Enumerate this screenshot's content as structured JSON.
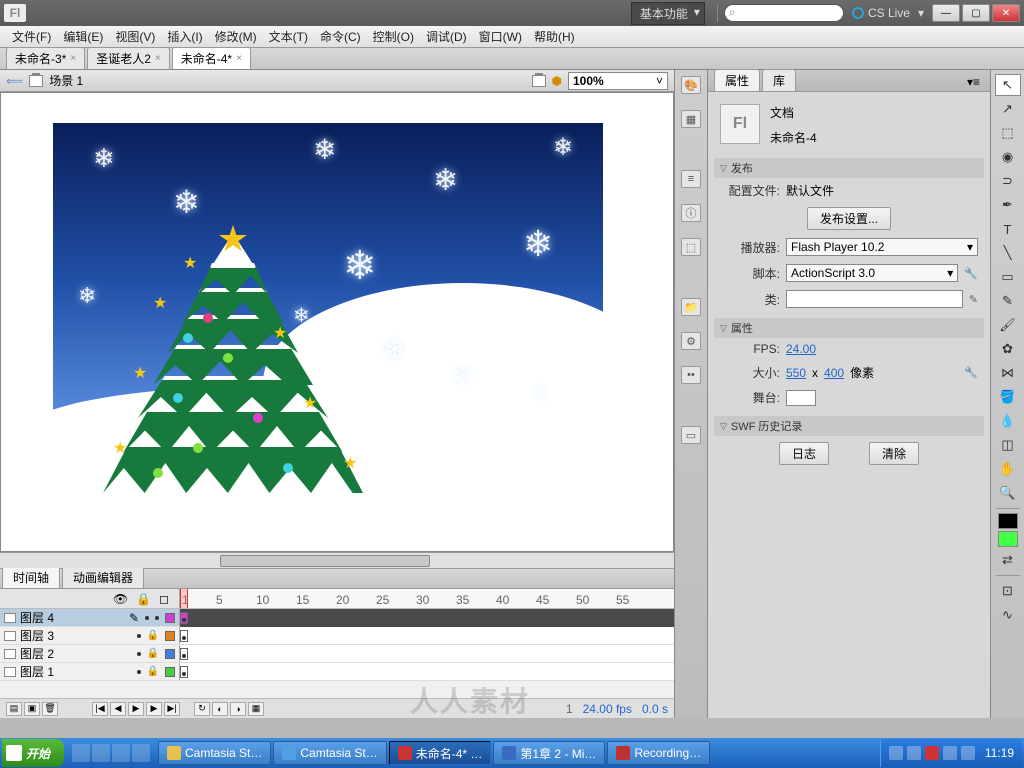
{
  "titlebar": {
    "logo": "Fl",
    "workspace": "基本功能",
    "cslive": "CS Live"
  },
  "menubar": {
    "items": [
      "文件(F)",
      "编辑(E)",
      "视图(V)",
      "插入(I)",
      "修改(M)",
      "文本(T)",
      "命令(C)",
      "控制(O)",
      "调试(D)",
      "窗口(W)",
      "帮助(H)"
    ]
  },
  "doc_tabs": {
    "items": [
      "未命名-3*",
      "圣诞老人2",
      "未命名-4*"
    ],
    "active": 2
  },
  "scene_bar": {
    "scene": "场景 1",
    "zoom": "100%"
  },
  "timeline_tabs": {
    "items": [
      "时间轴",
      "动画编辑器"
    ],
    "active": 0
  },
  "timeline": {
    "ruler": [
      "1",
      "5",
      "10",
      "15",
      "20",
      "25",
      "30",
      "35",
      "40",
      "45",
      "50",
      "55"
    ],
    "layers": [
      {
        "name": "图层 4",
        "locked": false,
        "color": "#d040d0",
        "selected": true
      },
      {
        "name": "图层 3",
        "locked": true,
        "color": "#e08020"
      },
      {
        "name": "图层 2",
        "locked": true,
        "color": "#4080e0"
      },
      {
        "name": "图层 1",
        "locked": true,
        "color": "#40d040"
      }
    ],
    "status": {
      "frame": "1",
      "fps": "24.00 fps",
      "time": "0.0 s"
    }
  },
  "properties": {
    "tabs": [
      "属性",
      "库"
    ],
    "doc_type": "文档",
    "doc_name": "未命名-4",
    "sections": {
      "publish": "发布",
      "props": "属性",
      "swf": "SWF 历史记录"
    },
    "publish": {
      "profile_label": "配置文件:",
      "profile_value": "默认文件",
      "settings_btn": "发布设置...",
      "player_label": "播放器:",
      "player_value": "Flash Player 10.2",
      "script_label": "脚本:",
      "script_value": "ActionScript 3.0",
      "class_label": "类:"
    },
    "props": {
      "fps_label": "FPS:",
      "fps_value": "24.00",
      "size_label": "大小:",
      "size_w": "550",
      "size_x": "x",
      "size_h": "400",
      "size_unit": "像素",
      "stage_label": "舞台:"
    },
    "swf": {
      "log_btn": "日志",
      "clear_btn": "清除"
    }
  },
  "taskbar": {
    "start": "开始",
    "tasks": [
      {
        "label": "Camtasia St…",
        "active": false
      },
      {
        "label": "Camtasia St…",
        "active": false
      },
      {
        "label": "未命名-4* …",
        "active": true,
        "icon": "#c33"
      },
      {
        "label": "第1章 2 - Mi…",
        "active": false
      },
      {
        "label": "Recording…",
        "active": false
      }
    ],
    "clock": "11:19"
  },
  "watermark": "人人素材"
}
